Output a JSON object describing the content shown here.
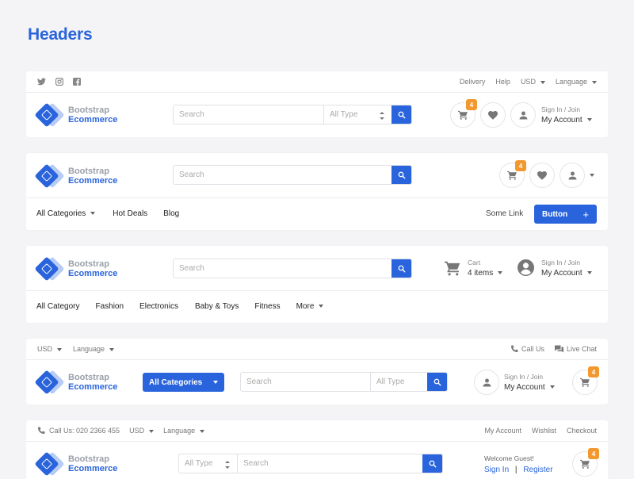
{
  "page": {
    "title": "Headers"
  },
  "colors": {
    "accent": "#2a64dc",
    "badge": "#f3982e",
    "background": "#f4f4f6"
  },
  "logo": {
    "line1": "Bootstrap",
    "line2": "Ecommerce"
  },
  "header1": {
    "social_icons": [
      "twitter-icon",
      "instagram-icon",
      "facebook-icon"
    ],
    "top_links": {
      "delivery": "Delivery",
      "help": "Help",
      "currency": "USD",
      "language": "Language"
    },
    "search": {
      "placeholder": "Search",
      "type": "All Type"
    },
    "cart_count": "4",
    "account": {
      "small": "Sign In / Join",
      "big": "My Account"
    }
  },
  "header2": {
    "search": {
      "placeholder": "Search"
    },
    "cart_count": "4",
    "nav": {
      "categories": "All Categories",
      "hot_deals": "Hot Deals",
      "blog": "Blog",
      "some_link": "Some Link",
      "button": "Button",
      "button_icon": "+"
    }
  },
  "header3": {
    "search": {
      "placeholder": "Search"
    },
    "cart": {
      "small": "Cart",
      "big": "4 items"
    },
    "account": {
      "small": "Sign In / Join",
      "big": "My Account"
    },
    "nav": [
      "All Category",
      "Fashion",
      "Electronics",
      "Baby & Toys",
      "Fitness"
    ],
    "more": "More"
  },
  "header4": {
    "top": {
      "currency": "USD",
      "language": "Language",
      "call_us": "Call Us",
      "live_chat": "Live Chat"
    },
    "categories_button": "All Categories",
    "search": {
      "placeholder": "Search",
      "type": "All Type"
    },
    "account": {
      "small": "Sign In / Join",
      "big": "My Account"
    },
    "cart_count": "4"
  },
  "header5": {
    "top": {
      "call": "Call Us: 020 2366 455",
      "currency": "USD",
      "language": "Language",
      "my_account": "My Account",
      "wishlist": "Wishlist",
      "checkout": "Checkout"
    },
    "search": {
      "placeholder": "Search",
      "type": "All Type"
    },
    "welcome": "Welcome Guest!",
    "sign_in": "Sign In",
    "separator": "|",
    "register": "Register",
    "cart_count": "4"
  }
}
